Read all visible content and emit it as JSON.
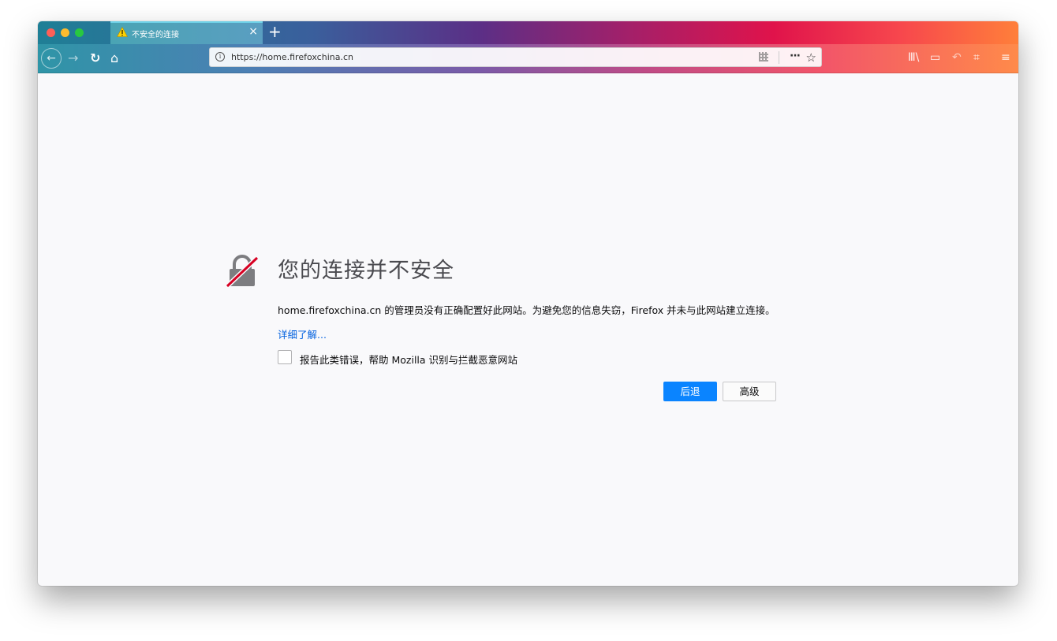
{
  "browser": {
    "tab": {
      "title": "不安全的连接",
      "close": "×"
    },
    "new_tab": "+",
    "nav": {
      "back": "←",
      "forward": "→",
      "reload": "↻",
      "home": "⌂"
    },
    "url": {
      "info": "i",
      "text": "https://home.firefoxchina.cn"
    },
    "page_actions": {
      "more": "···",
      "bookmark": "☆"
    },
    "right_tools": {
      "library": "Ⅲ\\",
      "sidebar": "▭",
      "undo": "↶",
      "screenshot": "⌗",
      "menu": "≡"
    }
  },
  "error_page": {
    "title": "您的连接并不安全",
    "description": "home.firefoxchina.cn 的管理员没有正确配置好此网站。为避免您的信息失窃，Firefox 并未与此网站建立连接。",
    "learn_more": "详细了解...",
    "report_label": "报告此类错误，帮助 Mozilla 识别与拦截恶意网站",
    "go_back": "后退",
    "advanced": "高级"
  },
  "colors": {
    "accent": "#0a84ff",
    "link": "#0060df",
    "warning": "#ffd200",
    "danger": "#d70022"
  },
  "icons": [
    "warning-icon",
    "info-icon",
    "qr-code-icon",
    "more-icon",
    "star-icon",
    "library-icon",
    "sidebar-icon",
    "undo-icon",
    "screenshot-icon",
    "menu-icon",
    "broken-lock-icon"
  ]
}
